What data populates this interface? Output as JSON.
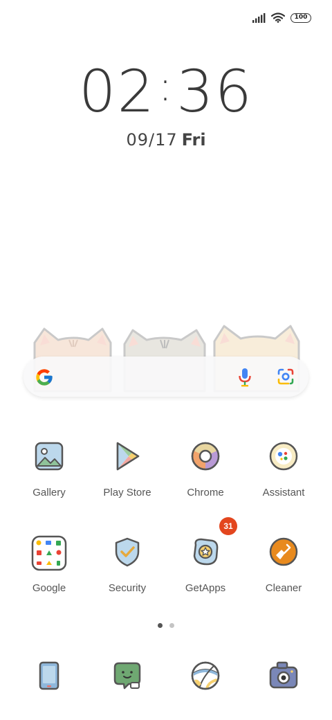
{
  "status_bar": {
    "signal_icon": "signal-bars-icon",
    "wifi_icon": "wifi-icon",
    "battery_level": "100"
  },
  "clock": {
    "hours": "02",
    "separator": ":",
    "minutes": "36"
  },
  "date": {
    "day": "09/17",
    "weekday": "Fri"
  },
  "search_bar": {
    "logo": "google-g-icon",
    "voice_icon": "microphone-icon",
    "lens_icon": "camera-lens-icon"
  },
  "apps_row1": [
    {
      "label": "Gallery",
      "icon": "gallery-icon"
    },
    {
      "label": "Play Store",
      "icon": "play-store-icon"
    },
    {
      "label": "Chrome",
      "icon": "chrome-icon"
    },
    {
      "label": "Assistant",
      "icon": "assistant-icon"
    }
  ],
  "apps_row2": [
    {
      "label": "Google",
      "icon": "google-folder-icon"
    },
    {
      "label": "Security",
      "icon": "shield-icon"
    },
    {
      "label": "GetApps",
      "icon": "getapps-icon",
      "badge": "31"
    },
    {
      "label": "Cleaner",
      "icon": "broom-icon"
    }
  ],
  "pager": {
    "pages": 2,
    "current": 1
  },
  "dock": [
    {
      "icon": "phone-icon"
    },
    {
      "icon": "messages-icon"
    },
    {
      "icon": "browser-ball-icon"
    },
    {
      "icon": "camera-icon"
    }
  ],
  "colors": {
    "badge": "#e3461e",
    "cleaner": "#e88a1e",
    "text": "#555555"
  }
}
